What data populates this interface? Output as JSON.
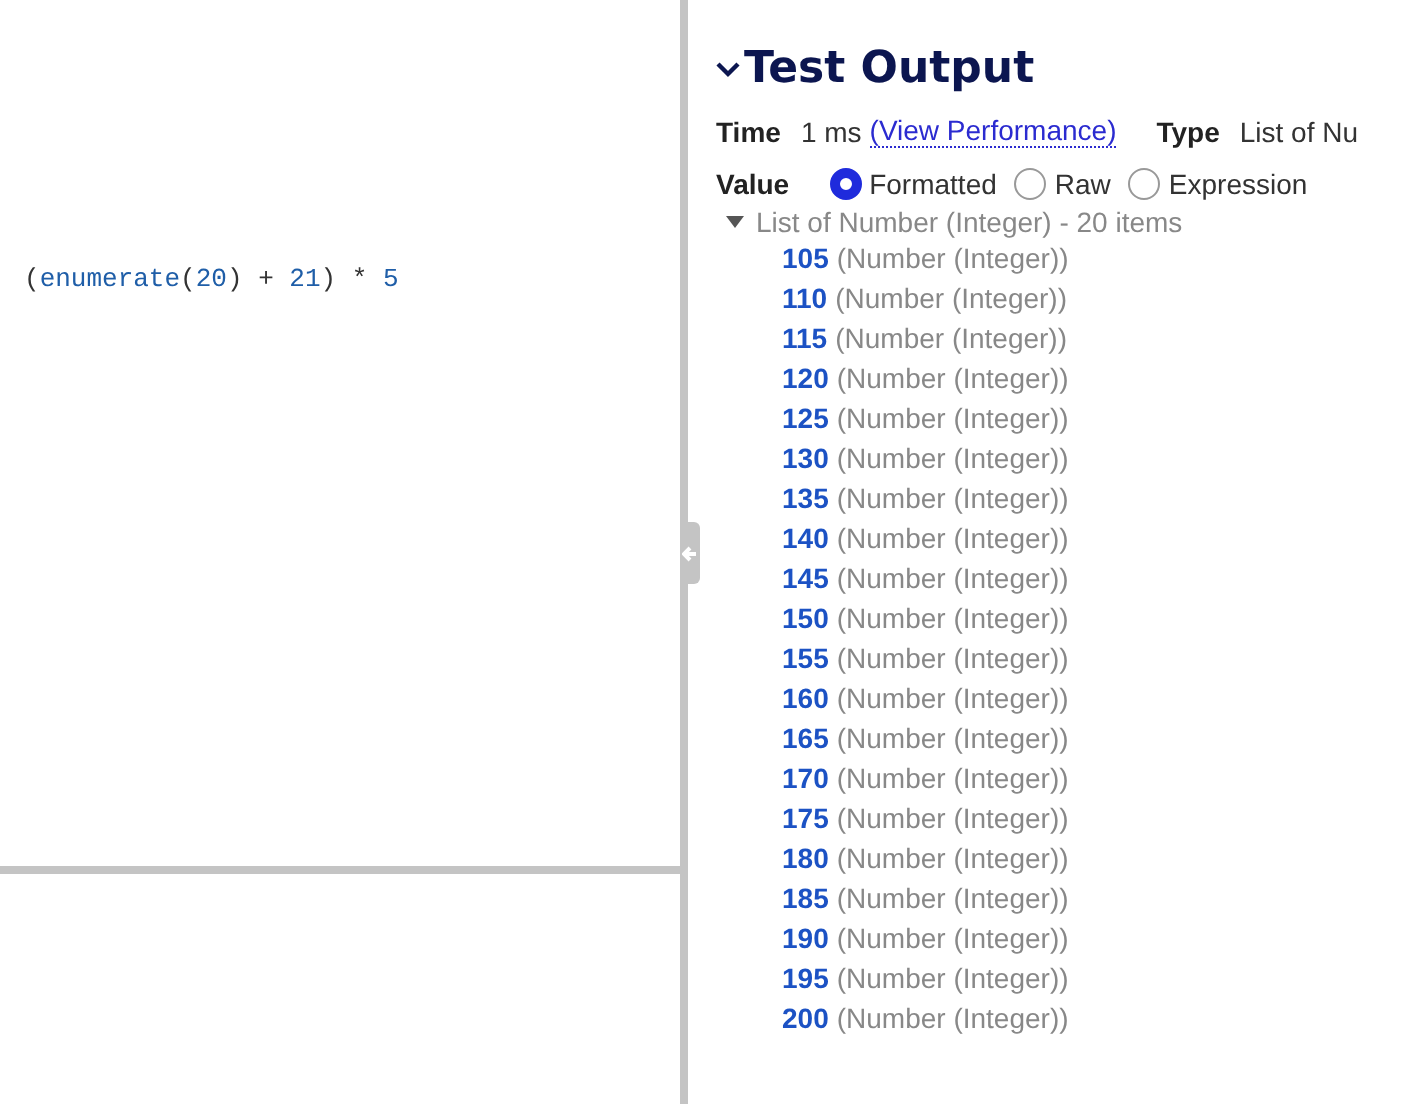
{
  "editor": {
    "code": [
      {
        "kind": "punct",
        "text": "("
      },
      {
        "kind": "func",
        "text": "enumerate"
      },
      {
        "kind": "punct",
        "text": "("
      },
      {
        "kind": "number",
        "text": "20"
      },
      {
        "kind": "punct",
        "text": ")"
      },
      {
        "kind": "op",
        "text": " + "
      },
      {
        "kind": "number",
        "text": "21"
      },
      {
        "kind": "punct",
        "text": ")"
      },
      {
        "kind": "op",
        "text": " * "
      },
      {
        "kind": "number",
        "text": "5"
      }
    ]
  },
  "output": {
    "title": "Test Output",
    "expanded": true,
    "time": {
      "label": "Time",
      "value": "1 ms",
      "link": "(View Performance)"
    },
    "type": {
      "label": "Type",
      "value": "List of Nu"
    },
    "value": {
      "label": "Value",
      "options": [
        {
          "label": "Formatted",
          "selected": true
        },
        {
          "label": "Raw",
          "selected": false
        },
        {
          "label": "Expression",
          "selected": false
        }
      ]
    },
    "list": {
      "label": "List of Number (Integer) - 20 items",
      "expanded": true,
      "items": [
        {
          "value": "105",
          "type": "(Number (Integer))"
        },
        {
          "value": "110",
          "type": "(Number (Integer))"
        },
        {
          "value": "115",
          "type": "(Number (Integer))"
        },
        {
          "value": "120",
          "type": "(Number (Integer))"
        },
        {
          "value": "125",
          "type": "(Number (Integer))"
        },
        {
          "value": "130",
          "type": "(Number (Integer))"
        },
        {
          "value": "135",
          "type": "(Number (Integer))"
        },
        {
          "value": "140",
          "type": "(Number (Integer))"
        },
        {
          "value": "145",
          "type": "(Number (Integer))"
        },
        {
          "value": "150",
          "type": "(Number (Integer))"
        },
        {
          "value": "155",
          "type": "(Number (Integer))"
        },
        {
          "value": "160",
          "type": "(Number (Integer))"
        },
        {
          "value": "165",
          "type": "(Number (Integer))"
        },
        {
          "value": "170",
          "type": "(Number (Integer))"
        },
        {
          "value": "175",
          "type": "(Number (Integer))"
        },
        {
          "value": "180",
          "type": "(Number (Integer))"
        },
        {
          "value": "185",
          "type": "(Number (Integer))"
        },
        {
          "value": "190",
          "type": "(Number (Integer))"
        },
        {
          "value": "195",
          "type": "(Number (Integer))"
        },
        {
          "value": "200",
          "type": "(Number (Integer))"
        }
      ]
    }
  }
}
